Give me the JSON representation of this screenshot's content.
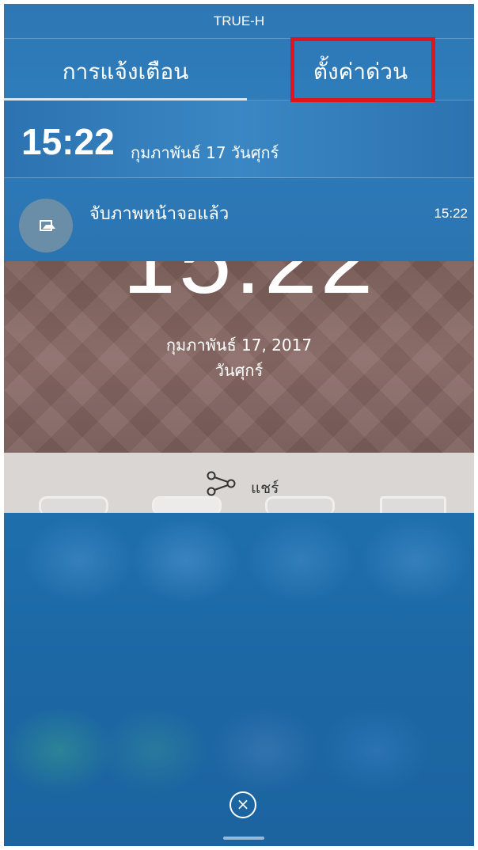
{
  "status_bar": {
    "carrier": "TRUE-H"
  },
  "tabs": [
    {
      "label": "การแจ้งเตือน",
      "active": true
    },
    {
      "label": "ตั้งค่าด่วน",
      "active": false,
      "highlighted": true
    }
  ],
  "header": {
    "time": "15:22",
    "date": "กุมภาพันธ์ 17  วันศุกร์"
  },
  "notification": {
    "icon": "image-icon",
    "title": "จับภาพหน้าจอแล้ว",
    "time": "15:22"
  },
  "lock_screen": {
    "clock": "15:22",
    "date": "กุมภาพันธ์ 17, 2017",
    "day": "วันศุกร์"
  },
  "share": {
    "label": "แชร์",
    "icon": "share-icon"
  },
  "controls": {
    "close_icon": "close-icon",
    "close_glyph": "×"
  },
  "colors": {
    "shade": "#2f7dbb",
    "highlight": "#e0141b",
    "panel": "#1c67a4"
  }
}
